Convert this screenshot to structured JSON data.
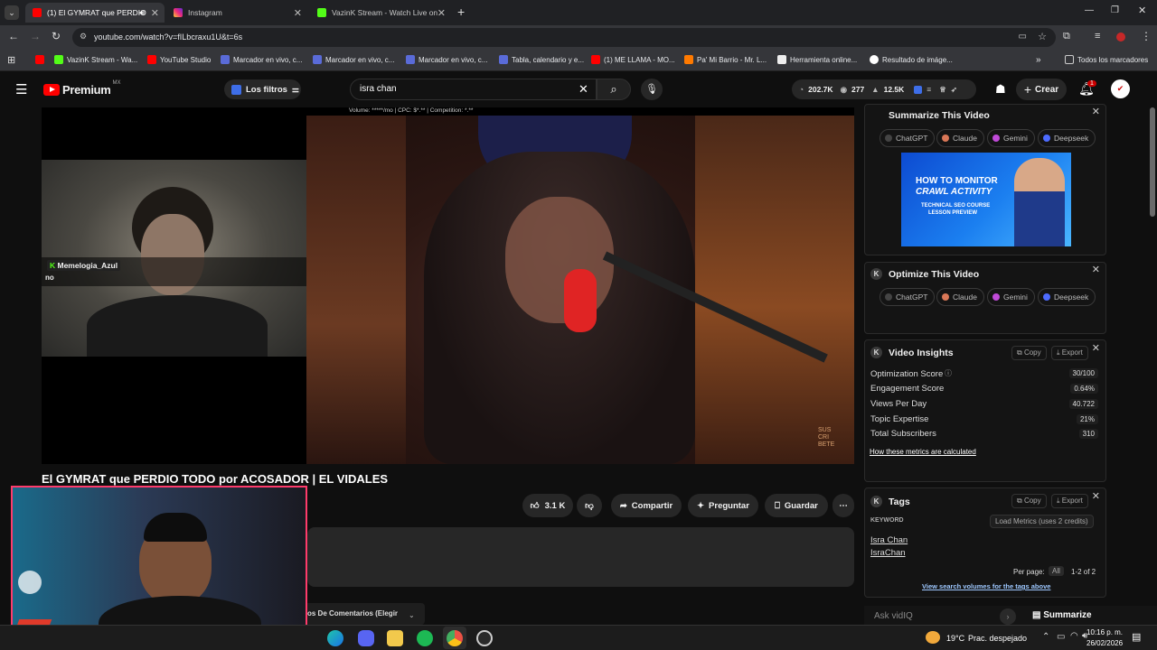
{
  "tabs": [
    {
      "label": "(1) El GYMRAT que PERDIO",
      "active": true
    },
    {
      "label": "Instagram",
      "active": false
    },
    {
      "label": "VazinK Stream - Watch Live on",
      "active": false
    }
  ],
  "browser": {
    "url": "youtube.com/watch?v=fILbcraxu1U&t=6s"
  },
  "bookmarks": [
    "VazinK Stream - Wa...",
    "YouTube Studio",
    "Marcador en vivo, c...",
    "Marcador en vivo, c...",
    "Marcador en vivo, c...",
    "Tabla, calendario y e...",
    "(1) ME LLAMA - MO...",
    "Pa' Mi Barrio - Mr. L...",
    "Herramienta online...",
    "Resultado de imáge..."
  ],
  "bookmarks_all": "Todos los marcadores",
  "yt": {
    "logo": "Premium",
    "logo_region": "MX",
    "filters": "Los filtros",
    "search": "isra chan",
    "stats": [
      "202.7K",
      "277",
      "12.5K"
    ],
    "create": "Crear",
    "notif": "1",
    "keyword_bar": "Volume: *****/mo | CPC: $*.** | Competition: *.**",
    "title": "El GYMRAT que PERDIO TODO por ACOSADOR | EL VIDALES",
    "like": "3.1 K",
    "share": "Compartir",
    "ask": "Preguntar",
    "save": "Guardar",
    "comments": "os De Comentarios (Elegir"
  },
  "overlay": {
    "chat_user": "Memelogia_Azul",
    "chat_msg": "no",
    "logo_text": "SUS CRI BETE"
  },
  "summarize": {
    "title": "Summarize This Video",
    "ai": [
      "ChatGPT",
      "Claude",
      "Gemini",
      "Deepseek"
    ],
    "thumb": {
      "line1": "HOW TO MONITOR",
      "line2": "CRAWL ACTIVITY",
      "line3": "TECHNICAL SEO COURSE",
      "line4": "LESSON PREVIEW"
    }
  },
  "optimize": {
    "title": "Optimize This Video",
    "ai": [
      "ChatGPT",
      "Claude",
      "Gemini",
      "Deepseek"
    ]
  },
  "insights": {
    "title": "Video Insights",
    "copy": "Copy",
    "export": "Export",
    "metrics": [
      {
        "label": "Optimization Score",
        "value": "30/100"
      },
      {
        "label": "Engagement Score",
        "value": "0.64%"
      },
      {
        "label": "Views Per Day",
        "value": "40.722"
      },
      {
        "label": "Topic Expertise",
        "value": "21%"
      },
      {
        "label": "Total Subscribers",
        "value": "310"
      }
    ],
    "link": "How these metrics are calculated"
  },
  "tags": {
    "title": "Tags",
    "copy": "Copy",
    "export": "Export",
    "col": "KEYWORD",
    "load": "Load Metrics (uses 2 credits)",
    "items": [
      "Isra Chan",
      "IsraChan"
    ],
    "per_page_label": "Per page:",
    "per_page": "All",
    "range": "1-2 of 2",
    "link": "View search volumes for the tags above"
  },
  "askbar": {
    "placeholder": "Ask vidIQ",
    "summarize": "Summarize"
  },
  "taskbar": {
    "weather": "19°C",
    "weather_text": "Prac. despejado",
    "time": "10:16 p. m.",
    "date": "26/02/2026"
  },
  "colors": {
    "yt_red": "#ff0000",
    "vidiq_blue": "#3ea6ff",
    "accent_purple": "#6b5bd6"
  }
}
